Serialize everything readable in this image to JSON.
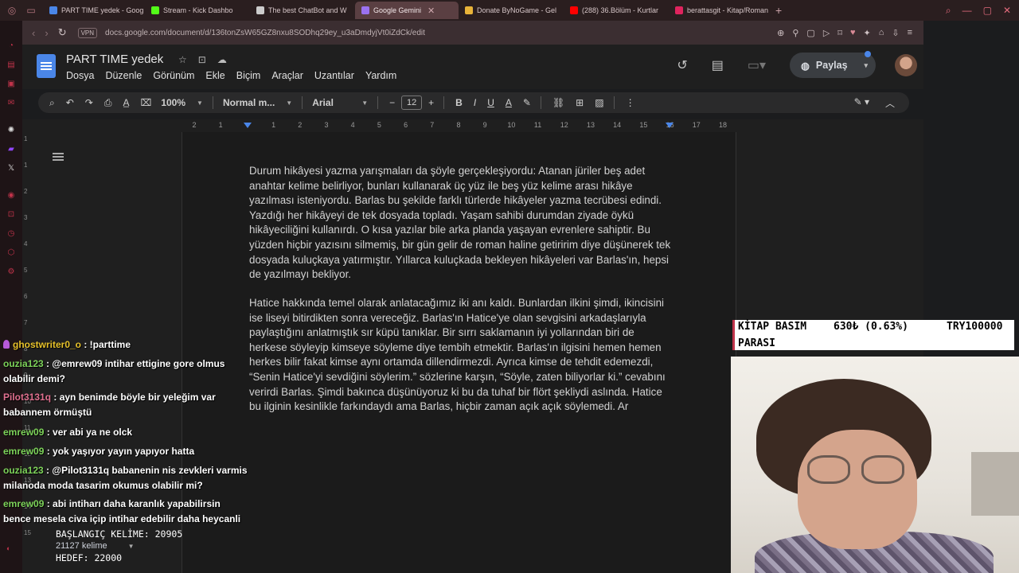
{
  "browser": {
    "tabs": [
      {
        "label": "PART TIME yedek - Goog",
        "active": false,
        "fav_color": "#4a86e8",
        "icon": "docs-icon"
      },
      {
        "label": "Stream - Kick Dashbo",
        "active": false,
        "fav_color": "#53fc18",
        "icon": "kick-icon"
      },
      {
        "label": "The best ChatBot and W",
        "active": false,
        "fav_color": "#cccccc",
        "icon": "chatbot-icon"
      },
      {
        "label": "Google Gemini",
        "active": true,
        "fav_color": "#9b72f0",
        "icon": "gemini-icon"
      },
      {
        "label": "Donate ByNoGame - Gel",
        "active": false,
        "fav_color": "#e8b339",
        "icon": "donate-icon"
      },
      {
        "label": "(288) 36.Bölüm - Kurtlar",
        "active": false,
        "fav_color": "#ff0000",
        "icon": "youtube-icon"
      },
      {
        "label": "berattasgit - Kitap/Roman",
        "active": false,
        "fav_color": "#e0245e",
        "icon": "bi-icon"
      }
    ],
    "vpn_label": "VPN",
    "url": "docs.google.com/document/d/136tonZsW65GZ8nxu8SODhq29ey_u3aDmdyjVt0iZdCk/edit"
  },
  "docs": {
    "title": "PART TIME  yedek",
    "menu": [
      "Dosya",
      "Düzenle",
      "Görünüm",
      "Ekle",
      "Biçim",
      "Araçlar",
      "Uzantılar",
      "Yardım"
    ],
    "share_label": "Paylaş",
    "toolbar": {
      "zoom": "100%",
      "style": "Normal m...",
      "font": "Arial",
      "font_size": "12"
    },
    "ruler_numbers": [
      "2",
      "1",
      "",
      "1",
      "2",
      "3",
      "4",
      "5",
      "6",
      "7",
      "8",
      "9",
      "10",
      "11",
      "12",
      "13",
      "14",
      "15",
      "16",
      "17",
      "18"
    ],
    "vruler_numbers": [
      "1",
      "1",
      "2",
      "3",
      "4",
      "5",
      "6",
      "7",
      "8",
      "9",
      "10",
      "11",
      "12",
      "13",
      "14",
      "15"
    ],
    "paragraph1": "Durum hikâyesi yazma yarışmaları da şöyle gerçekleşiyordu: Atanan jüriler beş adet anahtar kelime belirliyor, bunları kullanarak üç yüz ile beş yüz kelime arası hikâye yazılması isteniyordu. Barlas bu şekilde farklı türlerde hikâyeler yazma tecrübesi edindi. Yazdığı her hikâyeyi de tek dosyada topladı. Yaşam sahibi durumdan ziyade öykü hikâyeciliğini kullanırdı. O kısa yazılar bile arka planda yaşayan evrenlere sahiptir. Bu yüzden hiçbir yazısını silmemiş, bir gün gelir de roman haline getiririm diye düşünerek tek dosyada kuluçkaya yatırmıştır. Yıllarca kuluçkada bekleyen hikâyeleri var Barlas'ın, hepsi de yazılmayı bekliyor.",
    "paragraph2": "Hatice hakkında temel olarak anlatacağımız iki anı kaldı. Bunlardan ilkini şimdi, ikincisini ise liseyi bitirdikten sonra vereceğiz. Barlas'ın Hatice'ye olan sevgisini arkadaşlarıyla paylaştığını anlatmıştık sır küpü tanıklar. Bir sırrı saklamanın iyi yollarından biri de herkese söyleyip kimseye söyleme diye tembih etmektir. Barlas'ın ilgisini hemen hemen herkes bilir fakat kimse aynı ortamda dillendirmezdi. Ayrıca kimse de tehdit edemezdi, “Senin Hatice'yi sevdiğini söylerim.” sözlerine karşın, “Söyle, zaten biliyorlar ki.” cevabını verirdi Barlas. Şimdi bakınca düşünüyoruz ki bu da tuhaf bir flört şekliydi aslında. Hatice bu ilginin kesinlikle farkındaydı ama Barlas, hiçbir zaman açık açık söylemedi. Ar"
  },
  "chat": [
    {
      "user": "ghostwriter0_o",
      "color": "#e6c12a",
      "text": " : !parttime",
      "badge": true
    },
    {
      "user": "ouzia123",
      "color": "#7dd35a",
      "text": " : @emrew09 intihar ettigine gore olmus olabilir demi?",
      "badge": false
    },
    {
      "user": "Pilot3131q",
      "color": "#e0708f",
      "text": " : ayn benimde böyle bir yeleğim var babannem örmüştü",
      "badge": false
    },
    {
      "user": "emrew09",
      "color": "#7dd35a",
      "text": " : ver abi ya ne olck",
      "badge": false
    },
    {
      "user": "emrew09",
      "color": "#7dd35a",
      "text": " : yok yaşıyor yayın yapıyor hatta",
      "badge": false
    },
    {
      "user": "ouzia123",
      "color": "#7dd35a",
      "text": " : @Pilot3131q babanenin nis zevkleri varmis milanoda moda tasarim okumus olabilir mi?",
      "badge": false
    },
    {
      "user": "emrew09",
      "color": "#7dd35a",
      "text": " : abi intiharı daha karanlık yapabilirsin bence mesela civa içip intihar edebilir daha heycanli",
      "badge": false
    }
  ],
  "counter": {
    "start_line": "BAŞLANGIÇ KELİME: 20905",
    "count": "21127",
    "count_unit": "kelime",
    "target_line": "HEDEF: 22000"
  },
  "ticker": {
    "label1": "KİTAP BASIM",
    "amount": "630₺ (0.63%)",
    "goal": "TRY100000",
    "label2": "PARASI"
  },
  "colors": {
    "accent_blue": "#4a86e8",
    "ticker_border": "#c0334a"
  }
}
